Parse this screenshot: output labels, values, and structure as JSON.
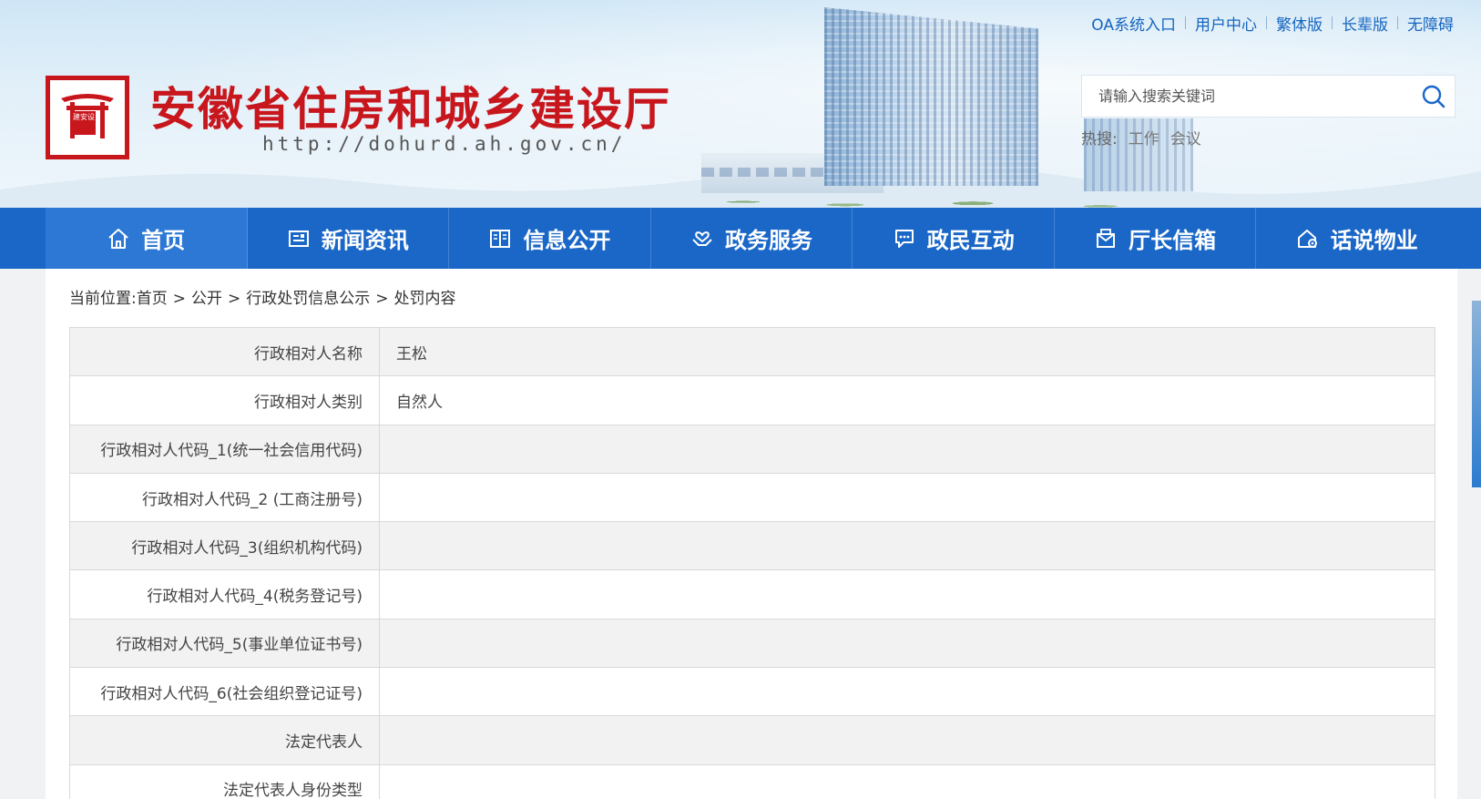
{
  "header": {
    "site_title": "安徽省住房和城乡建设厅",
    "site_url": "http://dohurd.ah.gov.cn/",
    "logo_seal_text": "建安设",
    "top_links": [
      "OA系统入口",
      "用户中心",
      "繁体版",
      "长辈版",
      "无障碍"
    ],
    "search": {
      "placeholder": "请输入搜索关键词",
      "value": ""
    },
    "hot_search": {
      "label": "热搜:",
      "items": [
        "工作",
        "会议"
      ]
    }
  },
  "nav": {
    "items": [
      {
        "label": "首页",
        "icon": "home-icon"
      },
      {
        "label": "新闻资讯",
        "icon": "news-icon"
      },
      {
        "label": "信息公开",
        "icon": "book-icon"
      },
      {
        "label": "政务服务",
        "icon": "hands-icon"
      },
      {
        "label": "政民互动",
        "icon": "chat-icon"
      },
      {
        "label": "厅长信箱",
        "icon": "mailbox-icon"
      },
      {
        "label": "话说物业",
        "icon": "house-gear-icon"
      }
    ]
  },
  "breadcrumb": {
    "prefix": "当前位置:",
    "items": [
      "首页",
      "公开",
      "行政处罚信息公示",
      "处罚内容"
    ]
  },
  "detail_table": {
    "rows": [
      {
        "label": "行政相对人名称",
        "value": "王松"
      },
      {
        "label": "行政相对人类别",
        "value": "自然人"
      },
      {
        "label": "行政相对人代码_1(统一社会信用代码)",
        "value": ""
      },
      {
        "label": "行政相对人代码_2 (工商注册号)",
        "value": ""
      },
      {
        "label": "行政相对人代码_3(组织机构代码)",
        "value": ""
      },
      {
        "label": "行政相对人代码_4(税务登记号)",
        "value": ""
      },
      {
        "label": "行政相对人代码_5(事业单位证书号)",
        "value": ""
      },
      {
        "label": "行政相对人代码_6(社会组织登记证号)",
        "value": ""
      },
      {
        "label": "法定代表人",
        "value": ""
      },
      {
        "label": "法定代表人身份类型",
        "value": ""
      }
    ]
  },
  "colors": {
    "brand_red": "#c8161d",
    "nav_blue": "#1a67c8",
    "link_blue": "#1565c0"
  }
}
